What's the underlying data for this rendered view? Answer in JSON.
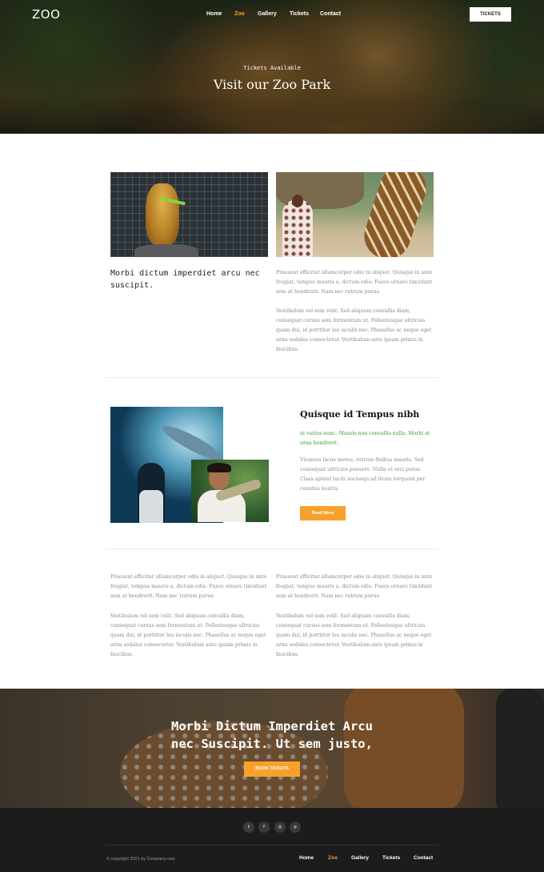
{
  "header": {
    "logo": "ZOO",
    "nav": [
      "Home",
      "Zoo",
      "Gallery",
      "Tickets",
      "Contact"
    ],
    "active_nav": "Zoo",
    "tickets_button": "TICKETS"
  },
  "hero": {
    "subtitle": "Tickets Available",
    "title": "Visit our Zoo Park"
  },
  "section1": {
    "heading": "Morbi dictum imperdiet arcu nec suscipit.",
    "para1": "Praesent efficitur ullamcorper odio in aliquet. Quisque in ante feugiat, tempus mauris a, dictum odio. Fusce ornare tincidunt sem at hendrerit. Nam nec rutrum purus.",
    "para2": "Vestibulum vel sem velit. Sed aliquam convallis diam, consequat cursus sem fermentum ut. Pellentesque ultricies quam dui, id porttitor leo iaculis nec. Phasellus ac neque eget urna sodales consectetur. Vestibulum ante ipsum primis in faucibus."
  },
  "section2": {
    "heading": "Quisque id Tempus nibh",
    "highlight": "in varius nunc. Mauris non convallis nulla. Morbi at urna hendrerit.",
    "para": "Vivamus lacus metus, rutrum finibus mauris. Sed consequat ultricies posuere. Nulla et orci purus. Class aptent taciti sociosqu ad litora torquent per conubia nostra.",
    "button": "Read More"
  },
  "section3": {
    "col1_para1": "Praesent efficitur ullamcorper odio in aliquet. Quisque in ante feugiat, tempus mauris a, dictum odio. Fusce ornare tincidunt sem at hendrerit. Nam nec rutrum purus.",
    "col1_para2": "Vestibulum vel sem velit. Sed aliquam convallis diam, consequat cursus sem fermentum ut. Pellentesque ultricies quam dui, id porttitor leo iaculis nec. Phasellus ac neque eget urna sodales consectetur. Vestibulum ante ipsum primis in faucibus.",
    "col2_para1": "Praesent efficitur ullamcorper odio in aliquet. Quisque in ante feugiat, tempus mauris a, dictum odio. Fusce ornare tincidunt sem at hendrerit. Nam nec rutrum purus.",
    "col2_para2": "Vestibulum vel sem velit. Sed aliquam convallis diam, consequat cursus sem fermentum ut. Pellentesque ultricies quam dui, id porttitor leo iaculis nec. Phasellus ac neque eget urna sodales consectetur. Vestibulum ante ipsum primis in faucibus."
  },
  "cta": {
    "title_line1": "Morbi Dictum Imperdiet Arcu",
    "title_line2": "nec Suscipit. Ut sem justo,",
    "button": "BOOK TICKETS"
  },
  "footer": {
    "social": [
      {
        "icon": "twitter-icon",
        "glyph": "t"
      },
      {
        "icon": "facebook-icon",
        "glyph": "f"
      },
      {
        "icon": "instagram-icon",
        "glyph": "◎"
      },
      {
        "icon": "pinterest-icon",
        "glyph": "p"
      }
    ],
    "copyright": "© copyright 2021 by Company.com",
    "nav": [
      "Home",
      "Zoo",
      "Gallery",
      "Tickets",
      "Contact"
    ],
    "active_nav": "Zoo"
  },
  "colors": {
    "accent": "#f7a12d",
    "highlight_text": "#3c9a3c",
    "footer_bg": "#1c1c1c"
  }
}
